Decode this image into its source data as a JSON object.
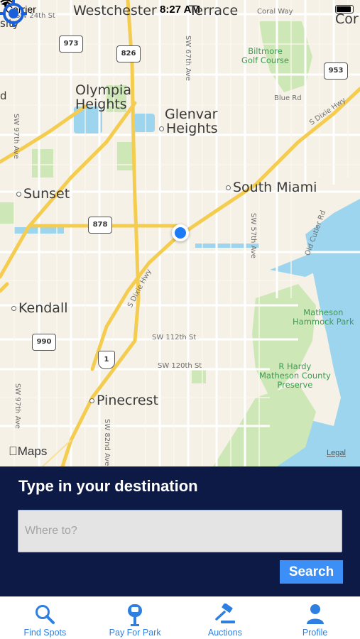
{
  "status_bar": {
    "carrier": "Carrier",
    "time": "8:27 AM"
  },
  "map": {
    "places": [
      {
        "id": "westchester",
        "name": "Westchester"
      },
      {
        "id": "terrace",
        "name": "Terrace"
      },
      {
        "id": "cor",
        "name": "Cor"
      },
      {
        "id": "olympia1",
        "name": "Olympia"
      },
      {
        "id": "olympia2",
        "name": "Heights"
      },
      {
        "id": "glenvar1",
        "name": "Glenvar"
      },
      {
        "id": "glenvar2",
        "name": "Heights"
      },
      {
        "id": "sunset",
        "name": "Sunset"
      },
      {
        "id": "south_miami",
        "name": "South Miami"
      },
      {
        "id": "kendall",
        "name": "Kendall"
      },
      {
        "id": "pinecrest",
        "name": "Pinecrest"
      },
      {
        "id": "sity",
        "name": "sity"
      },
      {
        "id": "d",
        "name": "d"
      }
    ],
    "streets": {
      "sw24": "SW 24th St",
      "coral_way": "Coral Way",
      "sw67": "SW 67th Ave",
      "blue_rd": "Blue Rd",
      "s_dixie_hwy_ne": "S Dixie Hwy",
      "sw97_top": "SW 97th Ave",
      "sw57": "SW 57th Ave",
      "old_cutler": "Old Cutler Rd",
      "s_dixie_hwy_sw": "S Dixie Hwy",
      "sw112": "SW 112th St",
      "sw120": "SW 120th St",
      "sw97_bottom": "SW 97th Ave",
      "sw82": "SW 82nd Ave"
    },
    "parks": {
      "biltmore": "Biltmore\nGolf Course",
      "matheson_hammock": "Matheson\nHammock Park",
      "r_hardy": "R Hardy\nMatheson County\nPreserve"
    },
    "shields": {
      "s973": "973",
      "s826": "826",
      "s953": "953",
      "s878": "878",
      "s990": "990",
      "us1": "1"
    },
    "attribution": "Maps",
    "legal": "Legal"
  },
  "destination": {
    "title": "Type in your destination",
    "placeholder": "Where to?",
    "value": "",
    "search_label": "Search"
  },
  "tabs": [
    {
      "label": "Find Spots",
      "icon": "search-icon"
    },
    {
      "label": "Pay For Park",
      "icon": "parking-meter-icon"
    },
    {
      "label": "Auctions",
      "icon": "gavel-icon"
    },
    {
      "label": "Profile",
      "icon": "person-icon"
    }
  ],
  "colors": {
    "panel_bg": "#0d1a45",
    "accent": "#3b8ff6",
    "tab_tint": "#2f7fe0",
    "map_land": "#f6f1e6",
    "highway": "#f4cc4f",
    "water": "#9dd5ef",
    "park": "#cde8b6"
  }
}
